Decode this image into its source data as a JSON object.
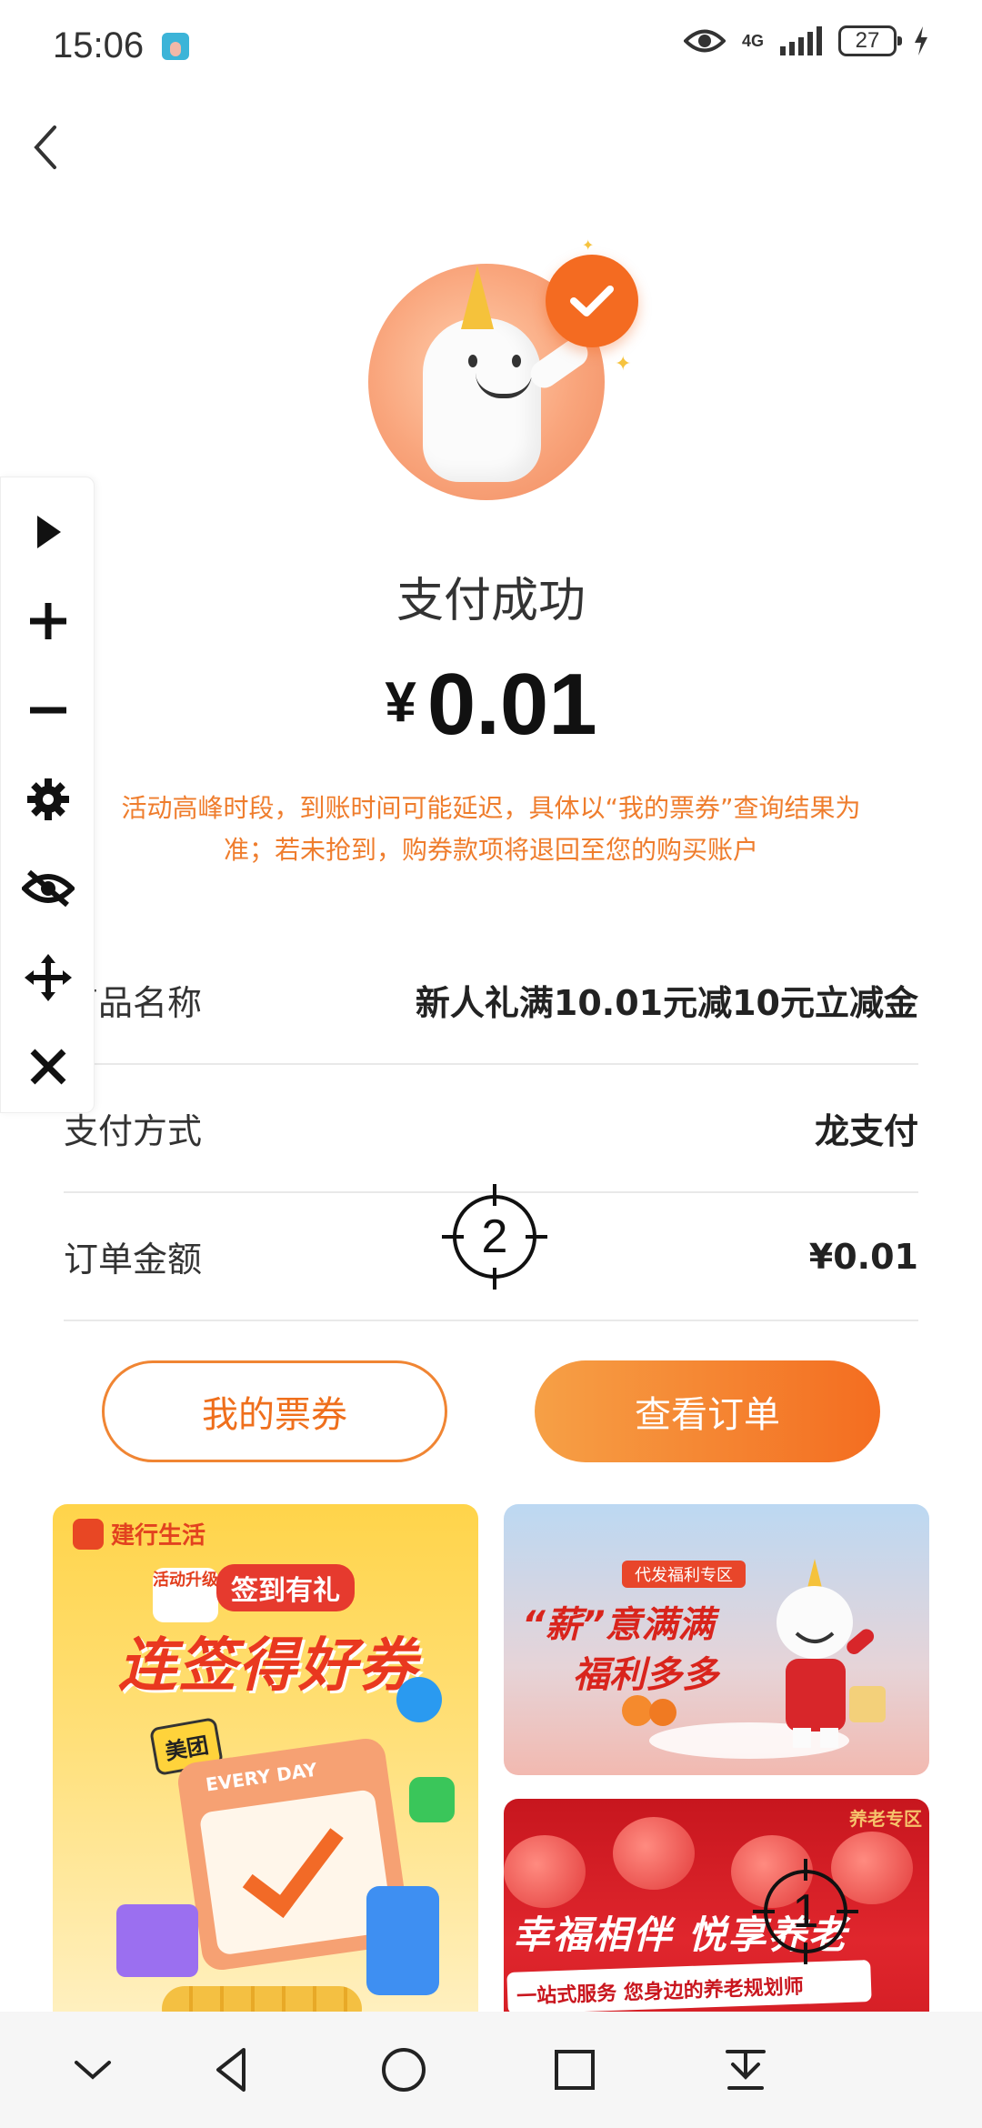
{
  "status_bar": {
    "time": "15:06",
    "network": "4G",
    "battery": "27"
  },
  "page": {
    "title": "支付成功",
    "currency": "¥",
    "amount": "0.01",
    "notice_line1": "活动高峰时段，到账时间可能延迟，具体以“我的票券”查询结果为",
    "notice_line2": "准；若未抢到，购券款项将退回至您的购买账户"
  },
  "details": [
    {
      "label": "商品名称",
      "value": "新人礼满10.01元减10元立减金"
    },
    {
      "label": "支付方式",
      "value": "龙支付"
    },
    {
      "label": "订单金额",
      "value": "¥0.01"
    }
  ],
  "buttons": {
    "my_tickets": "我的票券",
    "view_order": "查看订单"
  },
  "banners": {
    "left": {
      "brand": "建行生活",
      "upgrade": "活动升级",
      "tag": "签到有礼",
      "headline": "连签得好券",
      "calendar_text": "EVERY DAY",
      "meituan": "美团"
    },
    "right_top": {
      "tag": "代发福利专区",
      "line1": "“薪”意满满",
      "line2": "福利多多"
    },
    "right_bottom": {
      "tag": "养老专区",
      "headline": "幸福相伴 悦享养老",
      "sub": "一站式服务 您身边的养老规划师"
    }
  },
  "targets": {
    "one": "1",
    "two": "2"
  },
  "colors": {
    "accent": "#f46d20",
    "notice": "#ef7d2d",
    "outline": "#f08533"
  },
  "icons": {
    "toolbar": [
      "play-icon",
      "plus-icon",
      "minus-icon",
      "gear-icon",
      "eye-off-icon",
      "move-icon",
      "close-icon"
    ],
    "navbar": [
      "chevron-down-icon",
      "back-triangle-icon",
      "home-circle-icon",
      "recents-square-icon",
      "pull-down-icon"
    ]
  }
}
